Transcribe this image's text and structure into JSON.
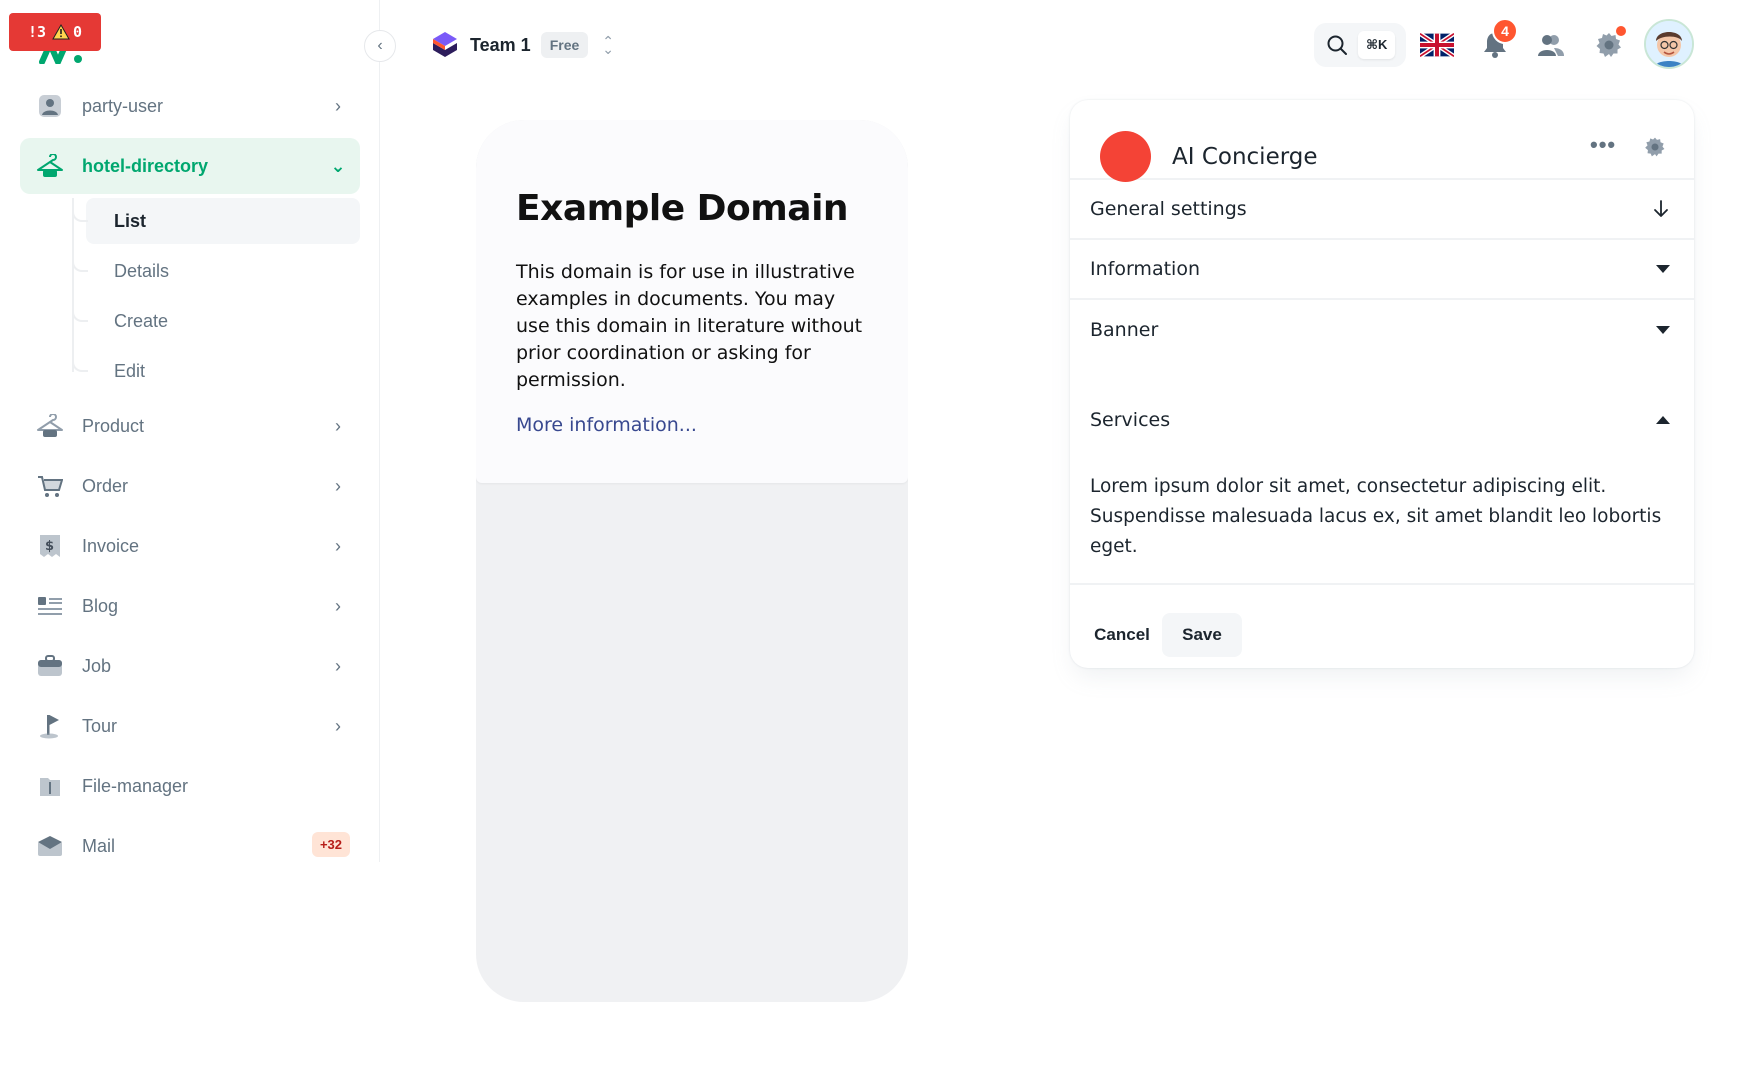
{
  "dev_badge": {
    "errors": "3",
    "warnings": "0"
  },
  "sidebar": {
    "items": [
      {
        "label": "party-user",
        "icon": "user-icon"
      },
      {
        "label": "hotel-directory",
        "icon": "hanger-icon",
        "active": true,
        "children": [
          {
            "label": "List",
            "active": true
          },
          {
            "label": "Details"
          },
          {
            "label": "Create"
          },
          {
            "label": "Edit"
          }
        ]
      },
      {
        "label": "Product",
        "icon": "hanger-icon"
      },
      {
        "label": "Order",
        "icon": "cart-icon"
      },
      {
        "label": "Invoice",
        "icon": "invoice-icon"
      },
      {
        "label": "Blog",
        "icon": "blog-icon"
      },
      {
        "label": "Job",
        "icon": "briefcase-icon"
      },
      {
        "label": "Tour",
        "icon": "flag-icon"
      },
      {
        "label": "File-manager",
        "icon": "folder-icon"
      },
      {
        "label": "Mail",
        "icon": "mail-icon",
        "badge": "+32"
      }
    ]
  },
  "header": {
    "team_name": "Team 1",
    "team_plan": "Free",
    "search_shortcut": "⌘K",
    "notifications_count": "4"
  },
  "preview": {
    "title": "Example Domain",
    "body": "This domain is for use in illustrative examples in documents. You may use this domain in literature without prior coordination or asking for permission.",
    "link": "More information..."
  },
  "panel": {
    "title": "AI Concierge",
    "accent_color": "#f44336",
    "sections": [
      {
        "label": "General settings",
        "state": "collapsed-arrow-down"
      },
      {
        "label": "Information",
        "state": "collapsed"
      },
      {
        "label": "Banner",
        "state": "collapsed"
      },
      {
        "label": "Services",
        "state": "expanded",
        "content": "Lorem ipsum dolor sit amet, consectetur adipiscing elit. Suspendisse malesuada lacus ex, sit amet blandit leo lobortis eget."
      }
    ],
    "cancel_label": "Cancel",
    "save_label": "Save"
  },
  "colors": {
    "primary": "#00a76f",
    "primary_bg": "#e8f6ef",
    "error": "#ff5630"
  }
}
